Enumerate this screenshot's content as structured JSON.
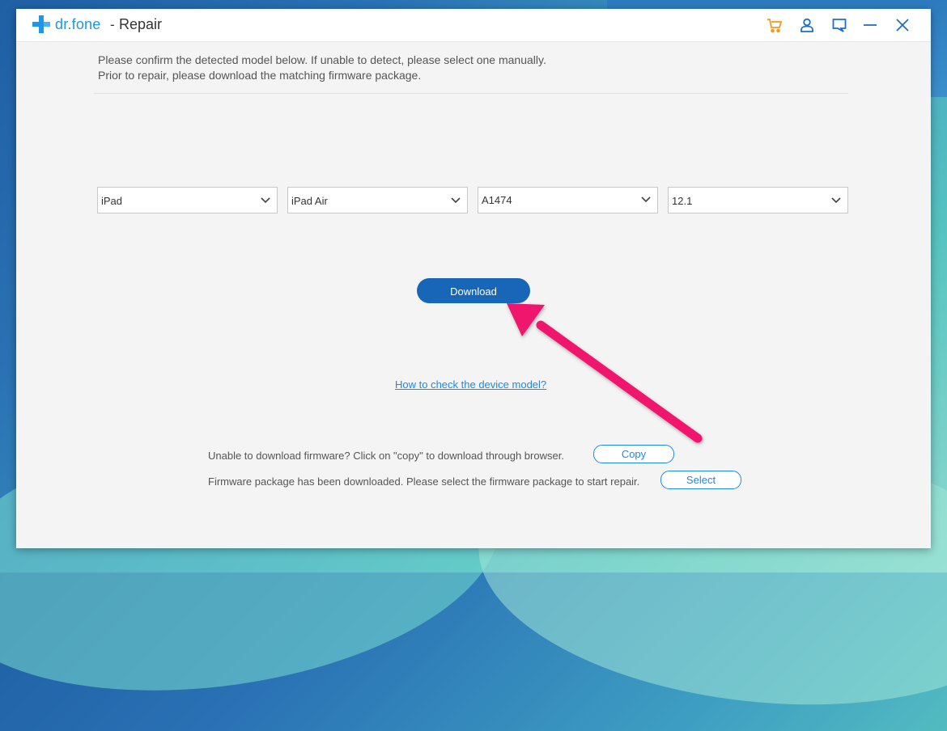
{
  "app": {
    "brand": "dr.fone",
    "separator": "-",
    "title": "Repair",
    "brand_color": "#1e97e6"
  },
  "titlebar": {
    "icons": [
      "cart-icon",
      "account-icon",
      "feedback-icon",
      "minimize-icon",
      "close-icon"
    ]
  },
  "instructions": {
    "line1": "Please confirm the detected model below. If unable to detect, please select one manually.",
    "line2": "Prior to repair, please download the matching firmware package."
  },
  "selectors": {
    "device_type": "iPad",
    "device_model": "iPad Air",
    "model_number": "A1474",
    "ios_version": "12.1"
  },
  "actions": {
    "download_label": "Download",
    "help_link": "How to check the device model?",
    "copy_prompt": "Unable to download firmware? Click on \"copy\" to download through browser.",
    "copy_label": "Copy",
    "select_prompt": "Firmware package has been downloaded. Please select the firmware package to start repair.",
    "select_label": "Select"
  },
  "colors": {
    "accent": "#1766b8",
    "link": "#1e88e5",
    "annotation_arrow": "#f0166e",
    "cart_icon": "#f29a1d"
  }
}
